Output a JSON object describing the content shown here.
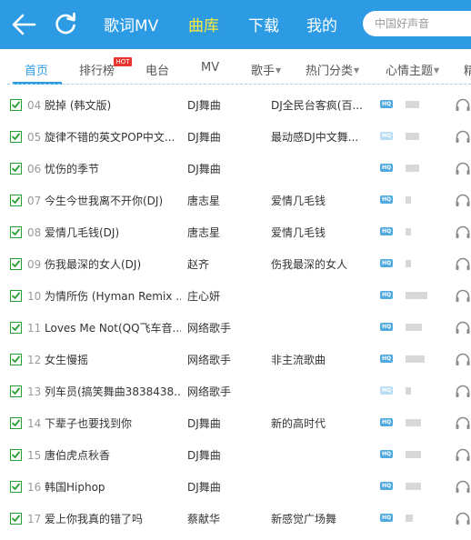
{
  "header": {
    "tabs": [
      {
        "label": "歌词MV",
        "active": false
      },
      {
        "label": "曲库",
        "active": true
      },
      {
        "label": "下载",
        "active": false
      },
      {
        "label": "我的",
        "active": false
      }
    ],
    "search_placeholder": "中国好声音",
    "back_icon": "back-arrow-icon",
    "refresh_icon": "refresh-icon"
  },
  "subnav": {
    "items": [
      {
        "label": "首页",
        "active": true,
        "dropdown": false
      },
      {
        "label": "排行榜",
        "active": false,
        "dropdown": false
      },
      {
        "label": "电台",
        "active": false,
        "dropdown": false
      },
      {
        "label": "MV",
        "active": false,
        "dropdown": false
      },
      {
        "label": "歌手",
        "active": false,
        "dropdown": true
      },
      {
        "label": "热门分类",
        "active": false,
        "dropdown": true
      },
      {
        "label": "心情主题",
        "active": false,
        "dropdown": true
      },
      {
        "label": "精",
        "active": false,
        "dropdown": false
      }
    ],
    "hot_badge": "HOT"
  },
  "quality_label": "HQ",
  "colors": {
    "accent": "#2d9be3",
    "active_tab": "#ffea3c",
    "checkbox": "#26a033",
    "hot": "#e8352e"
  },
  "songs": [
    {
      "num": "04",
      "title": "脱掉 (韩文版)",
      "artist": "DJ舞曲",
      "album": "DJ全民台客疯(百...",
      "hq": "dark",
      "popularity": 0.55,
      "checked": true
    },
    {
      "num": "05",
      "title": "旋律不错的英文POP中文...",
      "artist": "DJ舞曲",
      "album": "最动感DJ中文舞...",
      "hq": "light",
      "popularity": 0.55,
      "checked": true
    },
    {
      "num": "06",
      "title": "忧伤的季节",
      "artist": "DJ舞曲",
      "album": "",
      "hq": "dark",
      "popularity": 0.55,
      "checked": true
    },
    {
      "num": "07",
      "title": "今生今世我离不开你(DJ)",
      "artist": "唐志星",
      "album": "爱情几毛钱",
      "hq": "dark",
      "popularity": 0.2,
      "checked": true
    },
    {
      "num": "08",
      "title": "爱情几毛钱(DJ)",
      "artist": "唐志星",
      "album": "爱情几毛钱",
      "hq": "dark",
      "popularity": 0.2,
      "checked": true
    },
    {
      "num": "09",
      "title": "伤我最深的女人(DJ)",
      "artist": "赵齐",
      "album": "伤我最深的女人",
      "hq": "dark",
      "popularity": 0.2,
      "checked": true
    },
    {
      "num": "10",
      "title": "为情所伤 (Hyman Remix ...",
      "artist": "庄心妍",
      "album": "",
      "hq": "dark",
      "popularity": 0.85,
      "checked": true
    },
    {
      "num": "11",
      "title": "Loves Me Not(QQ飞车音...",
      "artist": "网络歌手",
      "album": "",
      "hq": "dark",
      "popularity": 0.65,
      "checked": true
    },
    {
      "num": "12",
      "title": "女生慢摇",
      "artist": "网络歌手",
      "album": "非主流歌曲",
      "hq": "dark",
      "popularity": 0.75,
      "checked": true
    },
    {
      "num": "13",
      "title": "列车员(搞笑舞曲3838438...",
      "artist": "网络歌手",
      "album": "",
      "hq": "light",
      "popularity": 0.2,
      "checked": true
    },
    {
      "num": "14",
      "title": "下辈子也要找到你",
      "artist": "DJ舞曲",
      "album": "新的高时代",
      "hq": "dark",
      "popularity": 0.6,
      "checked": true
    },
    {
      "num": "15",
      "title": "唐伯虎点秋香",
      "artist": "DJ舞曲",
      "album": "",
      "hq": "dark",
      "popularity": 0.6,
      "checked": true
    },
    {
      "num": "16",
      "title": "韩国Hiphop",
      "artist": "DJ舞曲",
      "album": "",
      "hq": "dark",
      "popularity": 0.6,
      "checked": true
    },
    {
      "num": "17",
      "title": "爱上你我真的错了吗",
      "artist": "蔡献华",
      "album": "新感觉广场舞",
      "hq": "dark",
      "popularity": 0.3,
      "checked": true
    }
  ]
}
